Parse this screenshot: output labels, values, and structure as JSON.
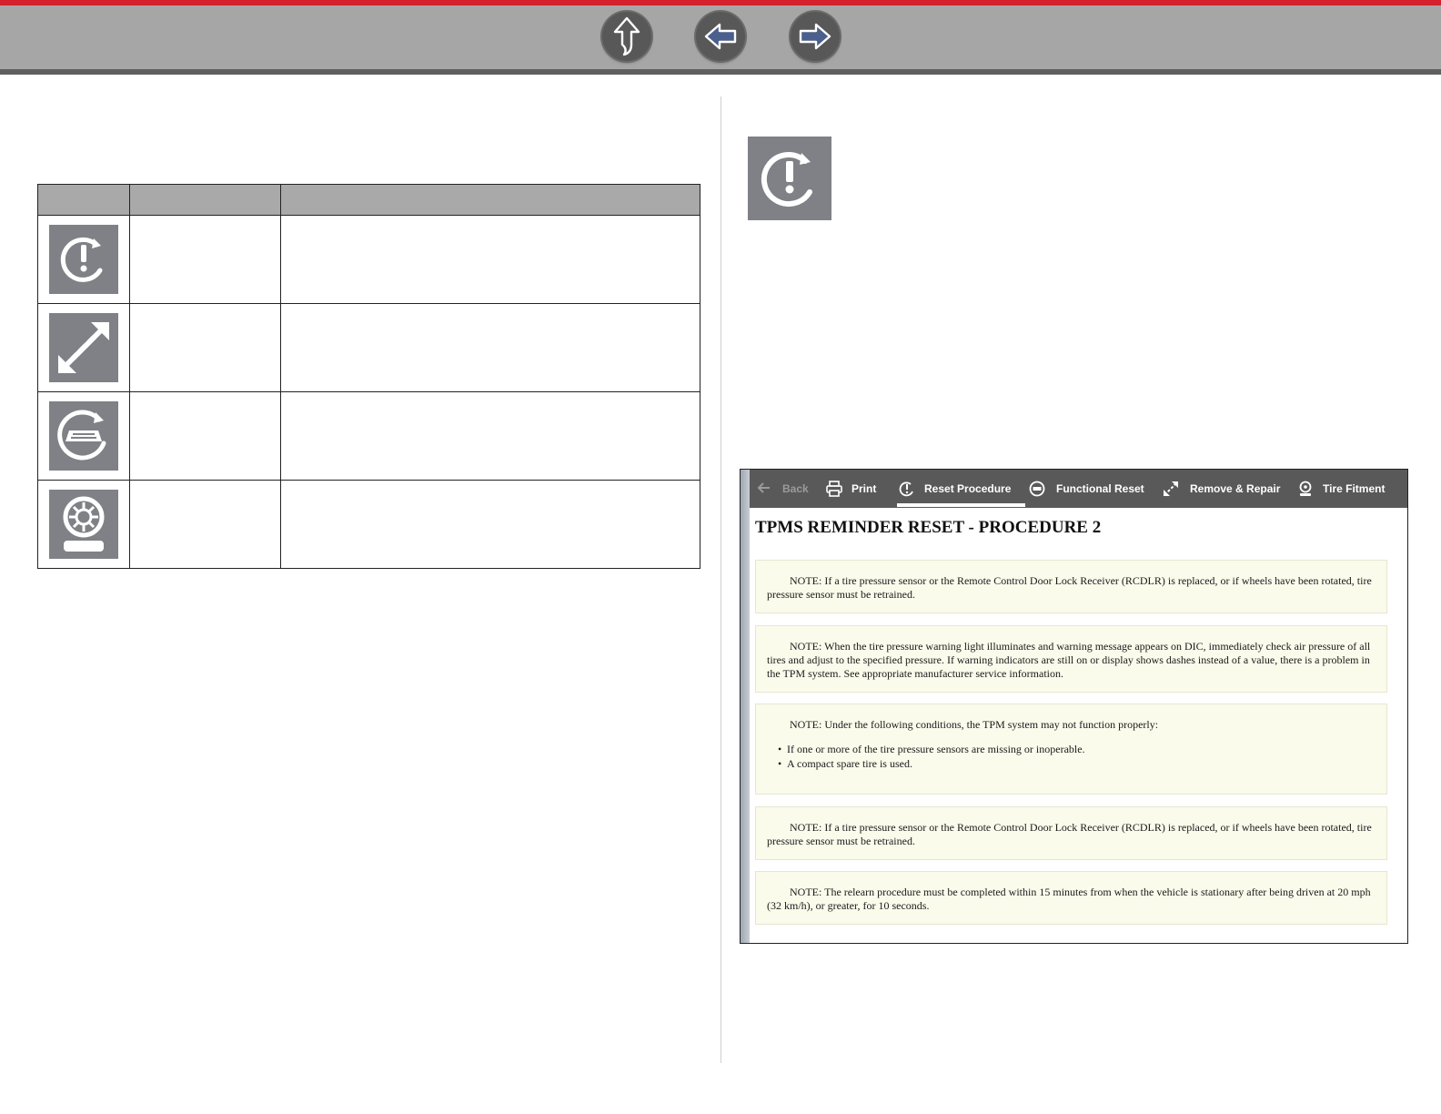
{
  "nav": {
    "up_icon": "arrow-up-icon",
    "back_icon": "arrow-left-icon",
    "next_icon": "arrow-right-icon"
  },
  "icon_table": {
    "header": [
      "",
      "",
      ""
    ],
    "rows": [
      {
        "icon": "reset-procedure-icon",
        "name": "",
        "description": ""
      },
      {
        "icon": "remove-repair-icon",
        "name": "",
        "description": ""
      },
      {
        "icon": "functional-reset-icon",
        "name": "",
        "description": ""
      },
      {
        "icon": "tire-fitment-icon",
        "name": "",
        "description": ""
      }
    ]
  },
  "featured_icon": "reset-procedure-icon",
  "screenshot": {
    "toolbar": {
      "back": "Back",
      "print": "Print",
      "reset_procedure": "Reset Procedure",
      "functional_reset": "Functional Reset",
      "remove_repair": "Remove & Repair",
      "tire_fitment": "Tire Fitment"
    },
    "title": "TPMS REMINDER RESET - PROCEDURE 2",
    "notes": [
      "NOTE: If a tire pressure sensor or the Remote Control Door Lock Receiver (RCDLR) is replaced, or if wheels have been rotated, tire pressure sensor must be retrained.",
      "NOTE: When the tire pressure warning light illuminates and warning message appears on DIC, immediately check air pressure of all tires and adjust to the specified pressure. If warning indicators are still on or display shows dashes instead of a value, there is a problem in the TPM system. See appropriate manufacturer service information.",
      "NOTE: Under the following conditions, the TPM system may not function properly:",
      "NOTE: If a tire pressure sensor or the Remote Control Door Lock Receiver (RCDLR) is replaced, or if wheels have been rotated, tire pressure sensor must be retrained.",
      "NOTE: The relearn procedure must be completed within 15 minutes from when the vehicle is stationary after being driven at 20 mph (32 km/h), or greater, for 10 seconds."
    ],
    "conditions": [
      "If one or more of the tire pressure sensors are missing or inoperable.",
      "A compact spare tire is used."
    ]
  },
  "colors": {
    "accent_red": "#d4202c",
    "nav_band": "#a6a6a6",
    "icon_tile": "#7f8186",
    "toolbar": "#595959",
    "note_bg": "#fbfbec"
  }
}
